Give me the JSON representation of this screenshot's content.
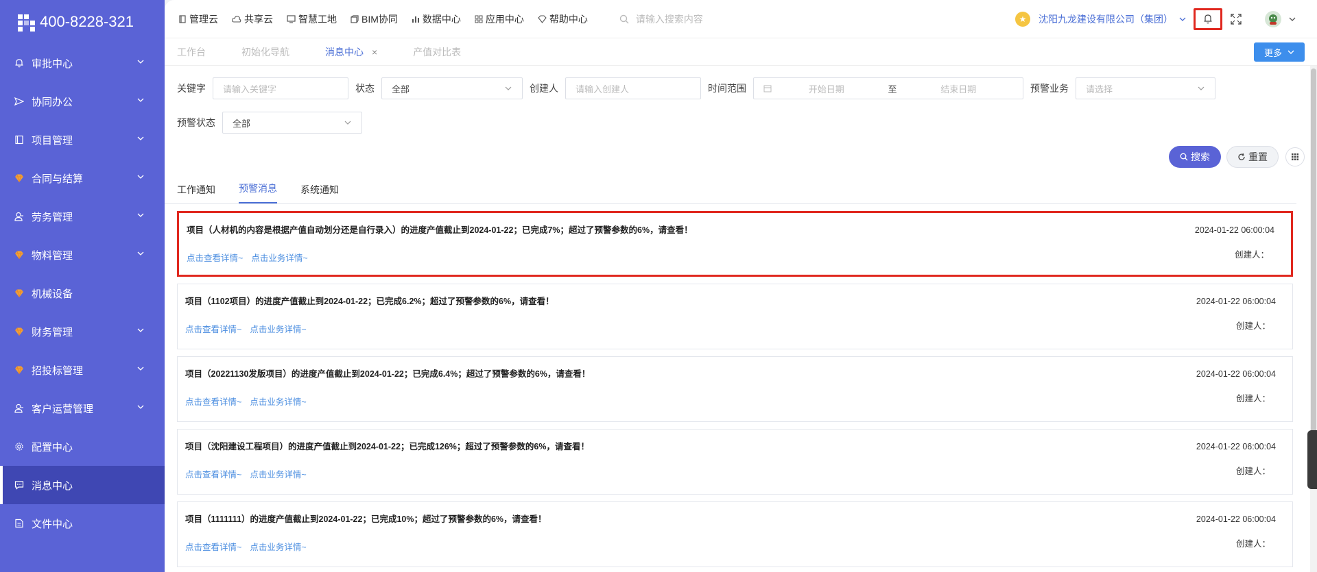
{
  "sidebar": {
    "phone": "400-8228-321",
    "items": [
      {
        "label": "审批中心",
        "icon": "bell-icon",
        "expandable": true
      },
      {
        "label": "协同办公",
        "icon": "send-icon",
        "expandable": true
      },
      {
        "label": "项目管理",
        "icon": "book-icon",
        "expandable": true
      },
      {
        "label": "合同与结算",
        "icon": "gem-icon",
        "expandable": true
      },
      {
        "label": "劳务管理",
        "icon": "worker-icon",
        "expandable": true
      },
      {
        "label": "物料管理",
        "icon": "gem-icon",
        "expandable": true
      },
      {
        "label": "机械设备",
        "icon": "gem-icon",
        "expandable": false
      },
      {
        "label": "财务管理",
        "icon": "gem-icon",
        "expandable": true
      },
      {
        "label": "招投标管理",
        "icon": "gem-icon",
        "expandable": true
      },
      {
        "label": "客户运营管理",
        "icon": "worker-icon",
        "expandable": true
      },
      {
        "label": "配置中心",
        "icon": "gear-icon",
        "expandable": false
      },
      {
        "label": "消息中心",
        "icon": "chat-icon",
        "expandable": false,
        "active": true
      },
      {
        "label": "文件中心",
        "icon": "file-icon",
        "expandable": false
      }
    ]
  },
  "topnav": {
    "items": [
      "管理云",
      "共享云",
      "智慧工地",
      "BIM协同",
      "数据中心",
      "应用中心",
      "帮助中心"
    ],
    "search_placeholder": "请输入搜索内容",
    "company": "沈阳九龙建设有限公司（集团）"
  },
  "tabs": {
    "items": [
      {
        "label": "工作台",
        "active": false
      },
      {
        "label": "初始化导航",
        "active": false
      },
      {
        "label": "消息中心",
        "active": true,
        "closable": true
      },
      {
        "label": "产值对比表",
        "active": false
      }
    ],
    "more": "更多"
  },
  "filters": {
    "keyword_label": "关键字",
    "keyword_placeholder": "请输入关键字",
    "status_label": "状态",
    "status_value": "全部",
    "creator_label": "创建人",
    "creator_placeholder": "请输入创建人",
    "range_label": "时间范围",
    "start_placeholder": "开始日期",
    "to": "至",
    "end_placeholder": "结束日期",
    "biz_label": "预警业务",
    "biz_placeholder": "请选择",
    "warn_status_label": "预警状态",
    "warn_status_value": "全部",
    "search_btn": "搜索",
    "reset_btn": "重置"
  },
  "msg_tabs": [
    {
      "label": "工作通知",
      "active": false
    },
    {
      "label": "预警消息",
      "active": true
    },
    {
      "label": "系统通知",
      "active": false
    }
  ],
  "messages": [
    {
      "title": "项目（人材机的内容是根据产值自动划分还是自行录入）的进度产值截止到2024-01-22；已完成7%；超过了预警参数的6%，请查看！",
      "time": "2024-01-22 06:00:04",
      "creator": "创建人：",
      "link1": "点击查看详情~",
      "link2": "点击业务详情~",
      "highlight": true
    },
    {
      "title": "项目（1102项目）的进度产值截止到2024-01-22；已完成6.2%；超过了预警参数的6%，请查看！",
      "time": "2024-01-22 06:00:04",
      "creator": "创建人：",
      "link1": "点击查看详情~",
      "link2": "点击业务详情~"
    },
    {
      "title": "项目（20221130发版项目）的进度产值截止到2024-01-22；已完成6.4%；超过了预警参数的6%，请查看！",
      "time": "2024-01-22 06:00:04",
      "creator": "创建人：",
      "link1": "点击查看详情~",
      "link2": "点击业务详情~"
    },
    {
      "title": "项目（沈阳建设工程项目）的进度产值截止到2024-01-22；已完成126%；超过了预警参数的6%，请查看！",
      "time": "2024-01-22 06:00:04",
      "creator": "创建人：",
      "link1": "点击查看详情~",
      "link2": "点击业务详情~"
    },
    {
      "title": "项目（1111111）的进度产值截止到2024-01-22；已完成10%；超过了预警参数的6%，请查看！",
      "time": "2024-01-22 06:00:04",
      "creator": "创建人：",
      "link1": "点击查看详情~",
      "link2": "点击业务详情~"
    }
  ],
  "colors": {
    "sidebar": "#5a63d6",
    "sidebar_active": "#3f47b3",
    "accent": "#4b6fd6",
    "highlight": "#e0281f"
  }
}
